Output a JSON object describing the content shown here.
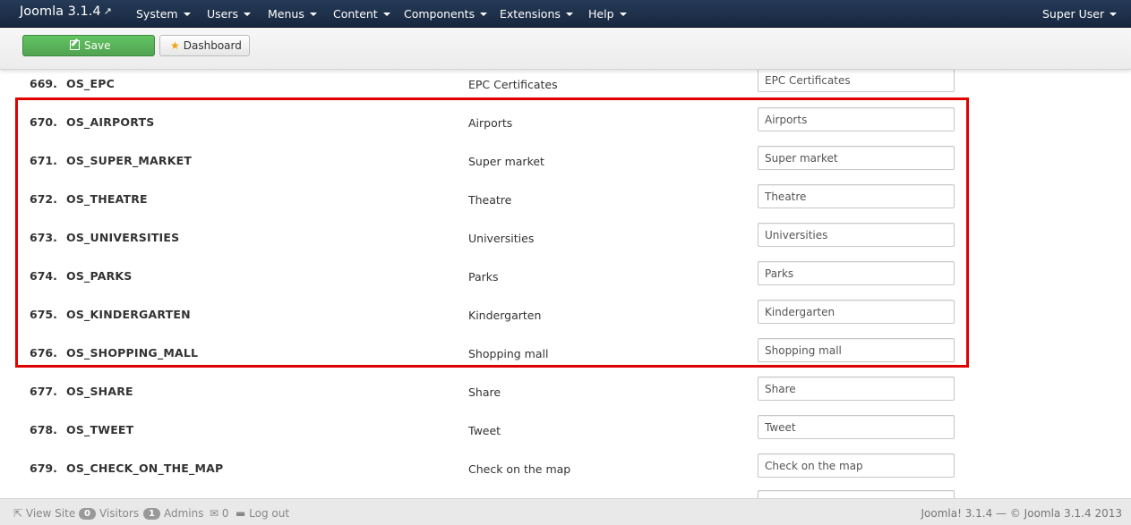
{
  "navbar": {
    "brand": "Joomla 3.1.4",
    "menus": [
      "System",
      "Users",
      "Menus",
      "Content",
      "Components",
      "Extensions",
      "Help"
    ],
    "user": "Super User"
  },
  "toolbar": {
    "save_label": "Save",
    "dashboard_label": "Dashboard"
  },
  "rows": [
    {
      "num": "669.",
      "key": "OS_EPC",
      "label": "EPC Certificates",
      "value": "EPC Certificates"
    },
    {
      "num": "670.",
      "key": "OS_AIRPORTS",
      "label": "Airports",
      "value": "Airports"
    },
    {
      "num": "671.",
      "key": "OS_SUPER_MARKET",
      "label": "Super market",
      "value": "Super market"
    },
    {
      "num": "672.",
      "key": "OS_THEATRE",
      "label": "Theatre",
      "value": "Theatre"
    },
    {
      "num": "673.",
      "key": "OS_UNIVERSITIES",
      "label": "Universities",
      "value": "Universities"
    },
    {
      "num": "674.",
      "key": "OS_PARKS",
      "label": "Parks",
      "value": "Parks"
    },
    {
      "num": "675.",
      "key": "OS_KINDERGARTEN",
      "label": "Kindergarten",
      "value": "Kindergarten"
    },
    {
      "num": "676.",
      "key": "OS_SHOPPING_MALL",
      "label": "Shopping mall",
      "value": "Shopping mall"
    },
    {
      "num": "677.",
      "key": "OS_SHARE",
      "label": "Share",
      "value": "Share"
    },
    {
      "num": "678.",
      "key": "OS_TWEET",
      "label": "Tweet",
      "value": "Tweet"
    },
    {
      "num": "679.",
      "key": "OS_CHECK_ON_THE_MAP",
      "label": "Check on the map",
      "value": "Check on the map"
    }
  ],
  "footer": {
    "view_site": "View Site",
    "visitors_count": "0",
    "visitors_label": "Visitors",
    "admins_count": "1",
    "admins_label": "Admins",
    "messages_count": "0",
    "logout": "Log out",
    "copyright": "Joomla! 3.1.4 — © Joomla 3.1.4 2013"
  },
  "colors": {
    "navbar": "#1e324d",
    "save_button": "#5bb75b",
    "highlight_border": "#e00000",
    "star": "#f0a20a"
  }
}
